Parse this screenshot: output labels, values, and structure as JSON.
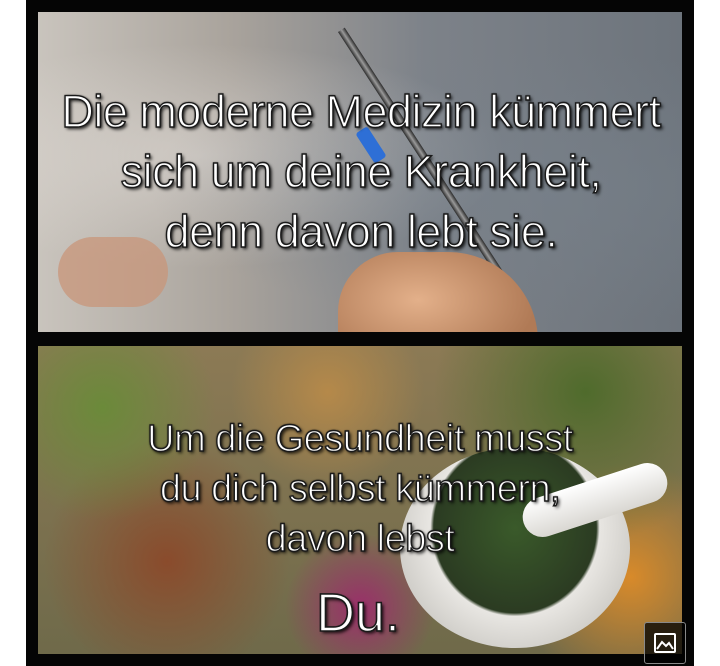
{
  "top_panel": {
    "caption_lines": [
      "Die moderne Medizin kümmert",
      "sich um deine Krankheit,",
      "denn davon lebt sie."
    ]
  },
  "bottom_panel": {
    "caption_lines": [
      "Um die Gesundheit musst",
      "du dich selbst kümmern,",
      "davon lebst"
    ],
    "emphasis": "Du."
  },
  "overlay": {
    "image_button_icon": "image-icon"
  }
}
